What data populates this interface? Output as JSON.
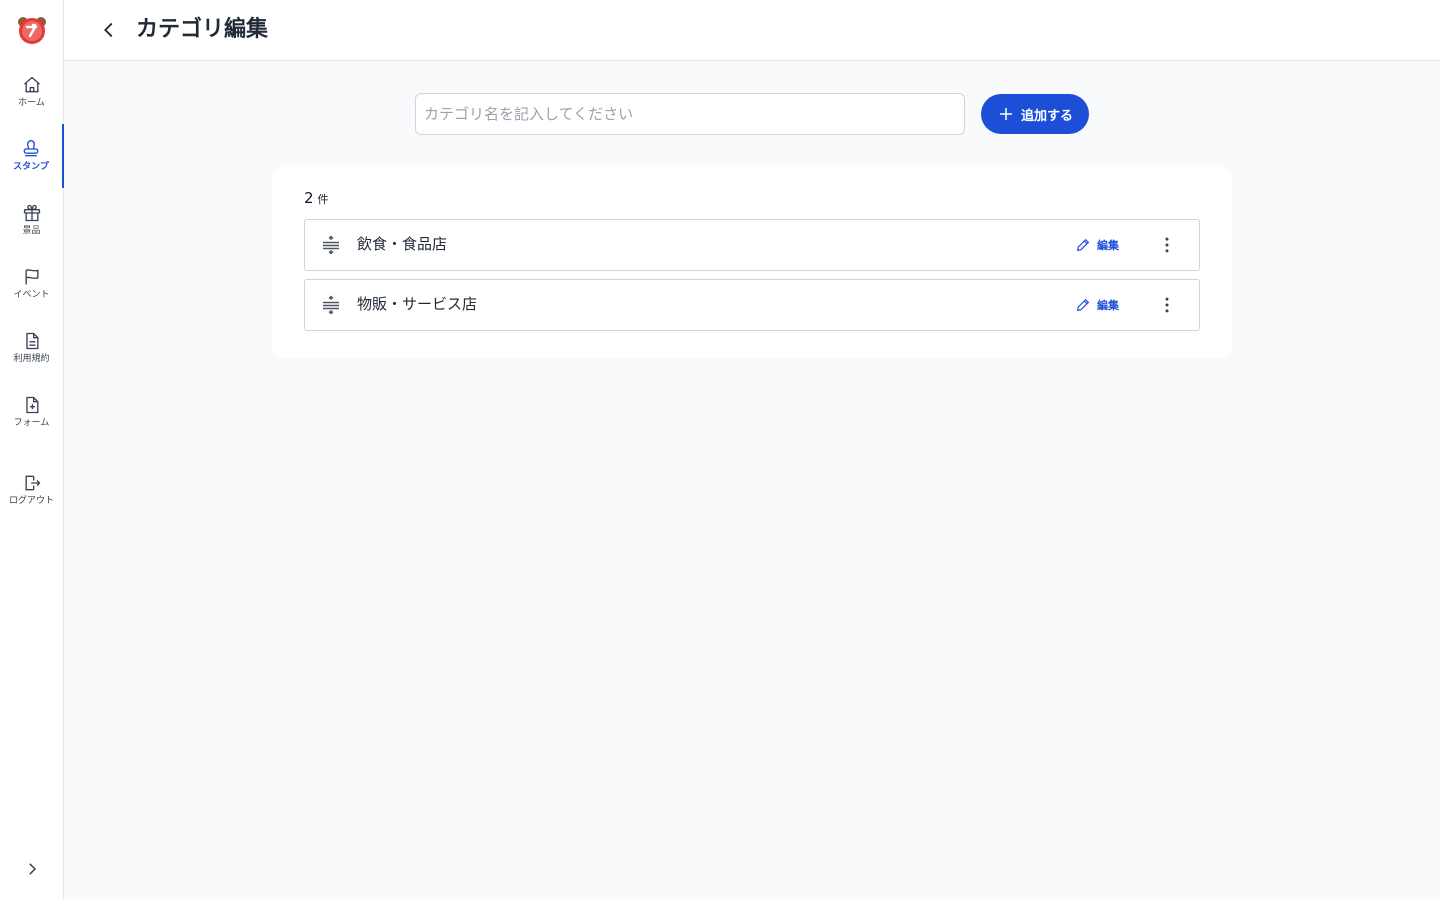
{
  "sidebar": {
    "items": [
      {
        "label": "ホーム",
        "icon": "home-icon"
      },
      {
        "label": "スタンプ",
        "icon": "stamp-icon",
        "active": true
      },
      {
        "label": "景品",
        "icon": "gift-icon"
      },
      {
        "label": "イベント",
        "icon": "flag-icon"
      },
      {
        "label": "利用規約",
        "icon": "document-icon"
      },
      {
        "label": "フォーム",
        "icon": "form-icon"
      },
      {
        "label": "ログアウト",
        "icon": "logout-icon"
      }
    ]
  },
  "header": {
    "title": "カテゴリ編集"
  },
  "form": {
    "input_placeholder": "カテゴリ名を記入してください",
    "input_value": "",
    "add_label": "追加する"
  },
  "list": {
    "count": "2",
    "count_unit": "件",
    "items": [
      {
        "label": "飲食・食品店",
        "edit_label": "編集"
      },
      {
        "label": "物販・サービス店",
        "edit_label": "編集"
      }
    ]
  },
  "colors": {
    "accent": "#1d4ed8",
    "logo_red": "#e53935",
    "logo_brown": "#8d5a3b"
  }
}
